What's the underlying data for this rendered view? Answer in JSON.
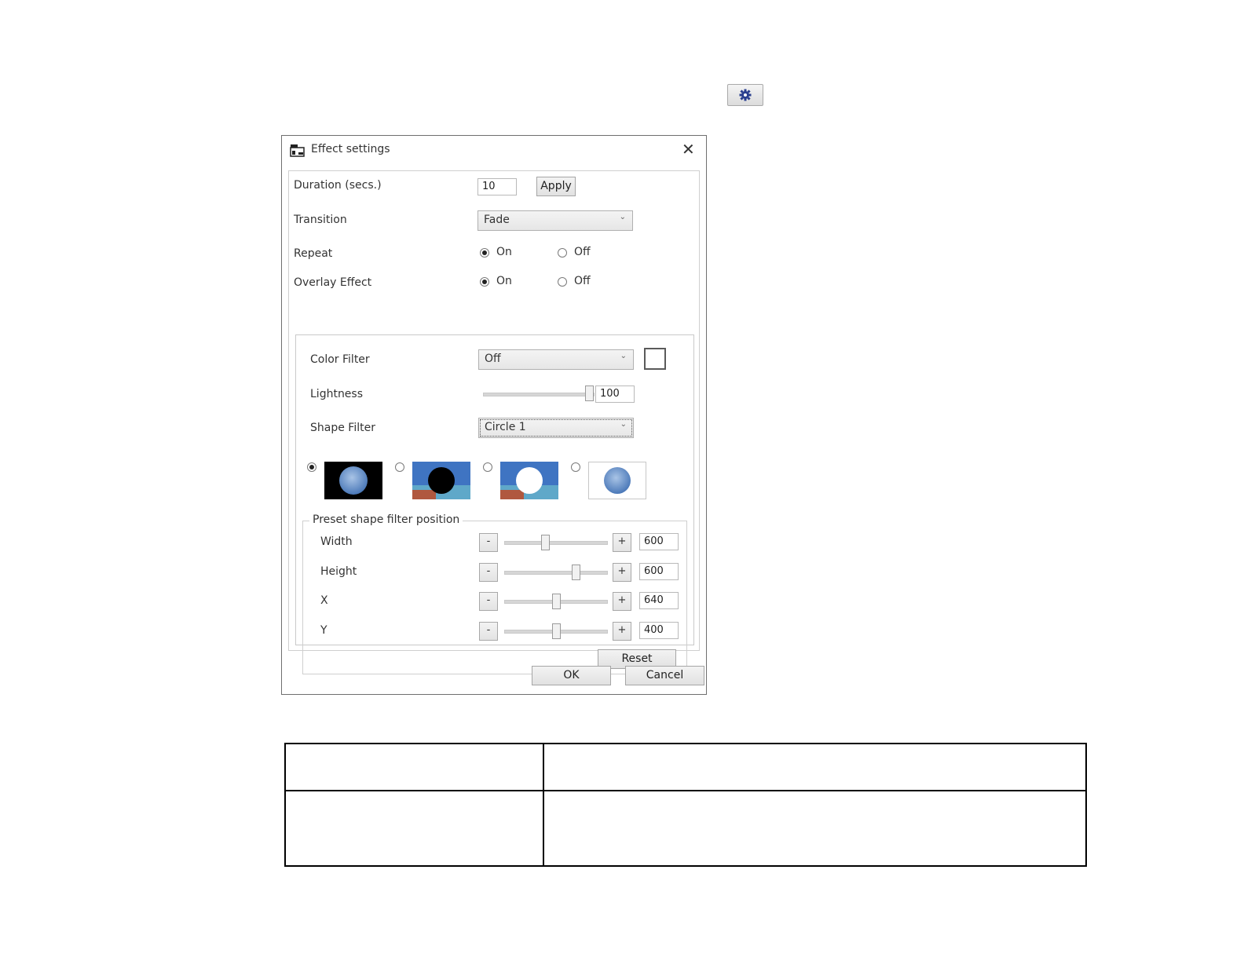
{
  "toolbar": {
    "gear_icon": "gear-icon"
  },
  "dialog": {
    "title": "Effect settings",
    "close_icon": "close-icon",
    "duration": {
      "label": "Duration (secs.)",
      "value": "10",
      "apply_label": "Apply"
    },
    "transition": {
      "label": "Transition",
      "selected": "Fade"
    },
    "repeat": {
      "label": "Repeat",
      "on_label": "On",
      "off_label": "Off",
      "selected": "On"
    },
    "overlay": {
      "label": "Overlay Effect",
      "on_label": "On",
      "off_label": "Off",
      "selected": "On"
    },
    "color_filter": {
      "label": "Color Filter",
      "selected": "Off"
    },
    "lightness": {
      "label": "Lightness",
      "value": "100"
    },
    "shape_filter": {
      "label": "Shape Filter",
      "selected": "Circle 1"
    },
    "shape_options": [
      {
        "name": "circle-on-black",
        "selected": true
      },
      {
        "name": "black-circle-on-image",
        "selected": false
      },
      {
        "name": "white-circle-on-image",
        "selected": false
      },
      {
        "name": "circle-on-white",
        "selected": false
      }
    ],
    "preset": {
      "legend": "Preset shape filter position",
      "minus_label": "-",
      "plus_label": "+",
      "rows": [
        {
          "label": "Width",
          "value": "600",
          "level": 0.4
        },
        {
          "label": "Height",
          "value": "600",
          "level": 0.7
        },
        {
          "label": "X",
          "value": "640",
          "level": 0.51
        },
        {
          "label": "Y",
          "value": "400",
          "level": 0.51
        }
      ],
      "reset_label": "Reset"
    },
    "ok_label": "OK",
    "cancel_label": "Cancel"
  }
}
